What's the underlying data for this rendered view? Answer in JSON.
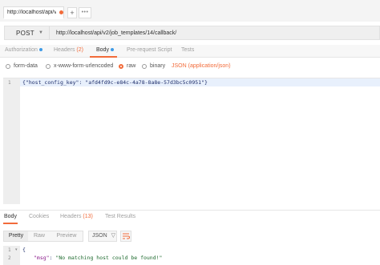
{
  "tabs": {
    "request_tab_label": "http://localhost/api/v",
    "add_label": "+",
    "more_label": "•••"
  },
  "request": {
    "method": "POST",
    "url": "http://localhost/api/v2/job_templates/14/callback/"
  },
  "request_subtabs": [
    {
      "label": "Authorization",
      "indicator": "blue-dot"
    },
    {
      "label": "Headers",
      "count": "(2)"
    },
    {
      "label": "Body",
      "indicator": "blue-dot",
      "active": true
    },
    {
      "label": "Pre-request Script"
    },
    {
      "label": "Tests"
    }
  ],
  "body_types": [
    {
      "label": "form-data",
      "selected": false
    },
    {
      "label": "x-www-form-urlencoded",
      "selected": false
    },
    {
      "label": "raw",
      "selected": true
    },
    {
      "label": "binary",
      "selected": false
    }
  ],
  "content_type": {
    "selected": "JSON (application/json)"
  },
  "request_body": {
    "line_numbers": [
      "1"
    ],
    "line_1_open": "{",
    "key": "\"host_config_key\"",
    "colon": ": ",
    "value": "\"afd4fd9c-e84c-4a78-8a8e-57d3bc5c0951\"",
    "line_1_close": "}"
  },
  "response_tabs": [
    {
      "label": "Body",
      "active": true
    },
    {
      "label": "Cookies"
    },
    {
      "label": "Headers",
      "count": "(13)"
    },
    {
      "label": "Test Results"
    }
  ],
  "response_format": {
    "modes": [
      "Pretty",
      "Raw",
      "Preview"
    ],
    "active_mode": "Pretty",
    "language": "JSON",
    "language_caret": "▽"
  },
  "response_body": {
    "line_numbers": [
      "1",
      "2"
    ],
    "line_1": "{",
    "key": "\"msg\"",
    "colon": ": ",
    "value": "\"No matching host could be found!\""
  },
  "colors": {
    "accent": "#f26b3a",
    "indicator": "#3f9be6",
    "code_text": "#1d2d6a"
  }
}
